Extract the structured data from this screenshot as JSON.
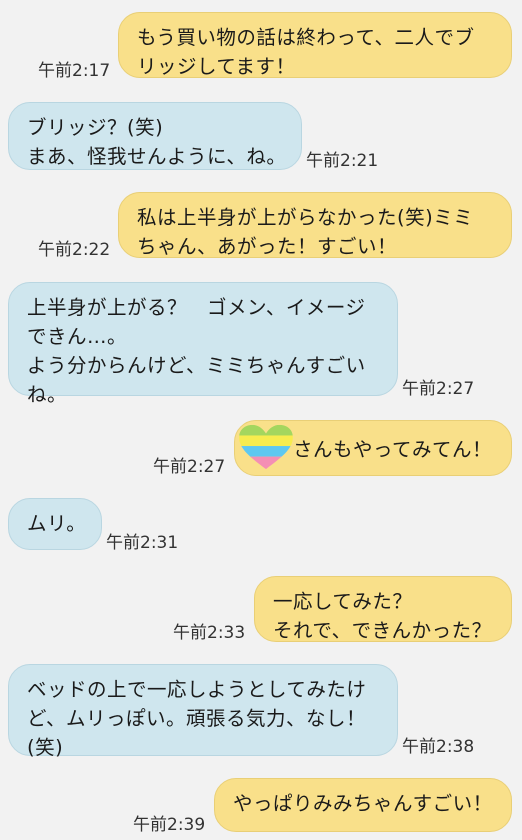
{
  "messages": [
    {
      "dir": "out",
      "lines": [
        "もう買い物の話は終わって、二人でブ",
        "リッジしてます！"
      ],
      "time": "午前2:17"
    },
    {
      "dir": "in",
      "lines": [
        "ブリッジ？(笑)",
        "まあ、怪我せんように、ね。"
      ],
      "time": "午前2:21"
    },
    {
      "dir": "out",
      "lines": [
        "私は上半身が上がらなかった(笑)ミミ",
        "ちゃん、あがった！すごい！"
      ],
      "time": "午前2:22"
    },
    {
      "dir": "in",
      "lines": [
        "上半身が上がる？　ゴメン、イメージ",
        "できん…。",
        "よう分からんけど、ミミちゃんすごい",
        "ね。"
      ],
      "time": "午前2:27"
    },
    {
      "dir": "out",
      "lines": [
        "さんもやってみてん！"
      ],
      "time": "午前2:27"
    },
    {
      "dir": "in",
      "lines": [
        "ムリ。"
      ],
      "time": "午前2:31"
    },
    {
      "dir": "out",
      "lines": [
        "一応してみた？",
        "それで、できんかった？"
      ],
      "time": "午前2:33"
    },
    {
      "dir": "in",
      "lines": [
        "ベッドの上で一応しようとしてみたけ",
        "ど、ムリっぽい。頑張る気力、なし！",
        "(笑)"
      ],
      "time": "午前2:38"
    },
    {
      "dir": "out",
      "lines": [
        "やっぱりみみちゃんすごい！"
      ],
      "time": "午前2:39"
    }
  ],
  "colors": {
    "background": "#f2f2f2",
    "incoming_bubble": "#cfe6ee",
    "outgoing_bubble": "#f9e08a"
  },
  "sticker_icon": "rainbow-heart-icon"
}
